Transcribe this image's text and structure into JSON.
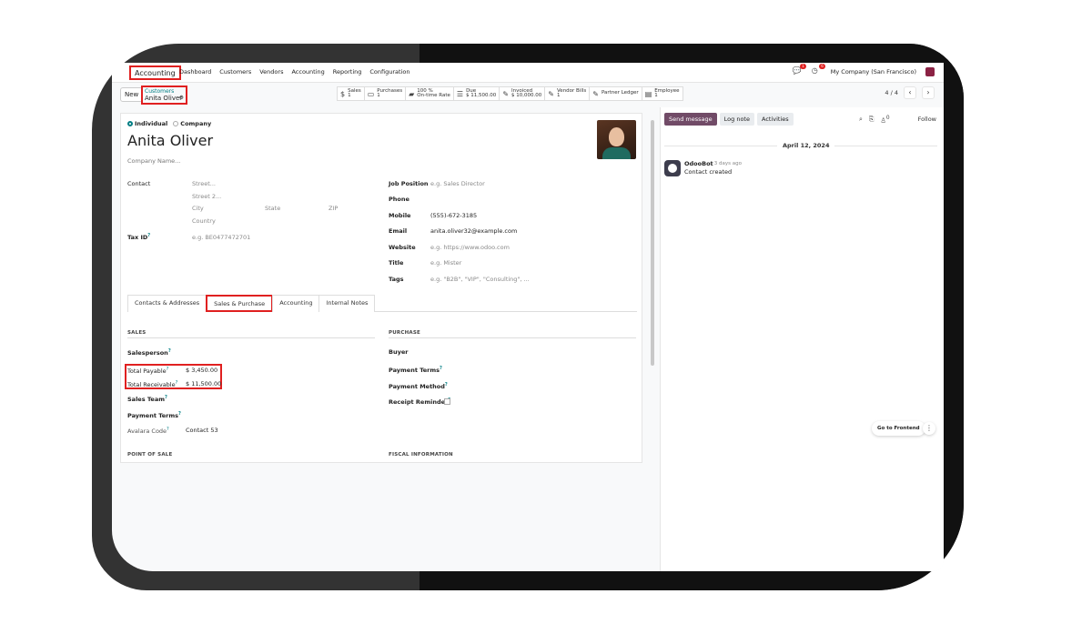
{
  "nav": {
    "app": "Accounting",
    "menu": [
      "Dashboard",
      "Customers",
      "Vendors",
      "Accounting",
      "Reporting",
      "Configuration"
    ],
    "messages_badge": "1",
    "activities_badge": "6",
    "company": "My Company (San Francisco)"
  },
  "control": {
    "new_label": "New",
    "breadcrumb_parent": "Customers",
    "breadcrumb_current": "Anita Oliver",
    "pager": "4 / 4"
  },
  "smart_buttons": [
    {
      "icon": "$",
      "title": "Sales",
      "value": "1"
    },
    {
      "icon": "▭",
      "title": "Purchases",
      "value": "1"
    },
    {
      "icon": "▰",
      "title": "100 %",
      "value": "On-time Rate"
    },
    {
      "icon": "☰",
      "title": "Due",
      "value": "$ 11,500.00"
    },
    {
      "icon": "✎",
      "title": "Invoiced",
      "value": "$ 10,000.00"
    },
    {
      "icon": "✎",
      "title": "Vendor Bills",
      "value": "1"
    },
    {
      "icon": "✎",
      "title": "Partner Ledger",
      "value": ""
    },
    {
      "icon": "▤",
      "title": "Employee",
      "value": "1"
    }
  ],
  "form": {
    "type_individual": "Individual",
    "type_company": "Company",
    "name": "Anita Oliver",
    "company_placeholder": "Company Name...",
    "contact_label": "Contact",
    "street": "Street...",
    "street2": "Street 2...",
    "city": "City",
    "state": "State",
    "zip": "ZIP",
    "country": "Country",
    "tax_id_label": "Tax ID",
    "tax_id_placeholder": "e.g. BE0477472701",
    "job_position_label": "Job Position",
    "job_position_placeholder": "e.g. Sales Director",
    "phone_label": "Phone",
    "mobile_label": "Mobile",
    "mobile_value": "(555)-672-3185",
    "email_label": "Email",
    "email_value": "anita.oliver32@example.com",
    "website_label": "Website",
    "website_placeholder": "e.g. https://www.odoo.com",
    "title_label": "Title",
    "title_placeholder": "e.g. Mister",
    "tags_label": "Tags",
    "tags_placeholder": "e.g. \"B2B\", \"VIP\", \"Consulting\", ..."
  },
  "tabs": [
    "Contacts & Addresses",
    "Sales & Purchase",
    "Accounting",
    "Internal Notes"
  ],
  "sales": {
    "heading": "SALES",
    "salesperson": "Salesperson",
    "total_payable_label": "Total Payable",
    "total_payable_value": "$ 3,450.00",
    "total_receivable_label": "Total Receivable",
    "total_receivable_value": "$ 11,500.00",
    "sales_team": "Sales Team",
    "payment_terms": "Payment Terms",
    "avalara_label": "Avalara Code",
    "avalara_value": "Contact 53",
    "pos_heading": "POINT OF SALE"
  },
  "purchase": {
    "heading": "PURCHASE",
    "buyer": "Buyer",
    "payment_terms": "Payment Terms",
    "payment_method": "Payment Method",
    "receipt_reminder": "Receipt Reminder",
    "fiscal_heading": "FISCAL INFORMATION"
  },
  "chatter": {
    "send_message": "Send message",
    "log_note": "Log note",
    "activities": "Activities",
    "followers_count": "0",
    "follow": "Follow",
    "date": "April 12, 2024",
    "author": "OdooBot",
    "ago": "- 3 days ago",
    "message": "Contact created",
    "go_frontend": "Go to Frontend"
  },
  "colors": {
    "accent": "#714b67",
    "highlight": "#e02020",
    "link": "#017e84"
  }
}
